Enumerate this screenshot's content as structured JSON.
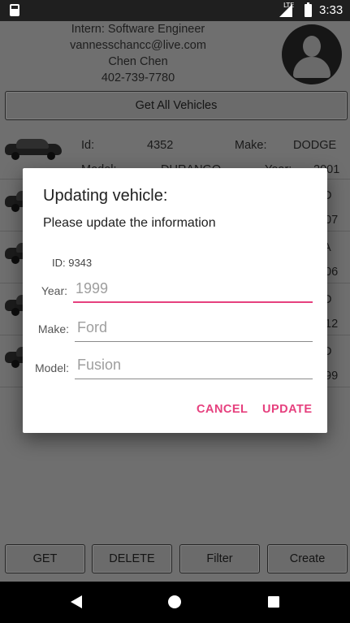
{
  "status_bar": {
    "time": "3:33",
    "network": "LTE"
  },
  "profile": {
    "role": "Intern: Software Engineer",
    "email": "vannesschancc@live.com",
    "name": "Chen Chen",
    "phone": "402-739-7780"
  },
  "actions": {
    "get_all": "Get All Vehicles"
  },
  "vehicles": {
    "labels": {
      "id": "Id:",
      "make": "Make:",
      "model": "Model:",
      "year": "Year:"
    },
    "rows": [
      {
        "id": "4352",
        "make": "DODGE",
        "model": "DURANGO",
        "year": "2001"
      },
      {
        "make_partial": "D",
        "year_partial": "07"
      },
      {
        "make_partial": "A",
        "year_partial": "06"
      },
      {
        "make_partial": "D",
        "year_partial": "12"
      },
      {
        "make_partial": "D",
        "year_partial": "99"
      }
    ]
  },
  "bottom_buttons": {
    "get": "GET",
    "delete": "DELETE",
    "filter": "Filter",
    "create": "Create"
  },
  "dialog": {
    "title": "Updating vehicle:",
    "message": "Please update the information",
    "id_text": "ID: 9343",
    "year_label": "Year:",
    "year_placeholder": "1999",
    "make_label": "Make:",
    "make_placeholder": "Ford",
    "model_label": "Model:",
    "model_placeholder": "Fusion",
    "cancel": "CANCEL",
    "update": "UPDATE"
  },
  "colors": {
    "accent": "#e6407e",
    "dim_background": "#6f6f6f"
  },
  "icons": {
    "status_left": "sd-card-icon",
    "avatar": "person-icon",
    "nav": [
      "back-icon",
      "home-icon",
      "recents-icon"
    ]
  }
}
